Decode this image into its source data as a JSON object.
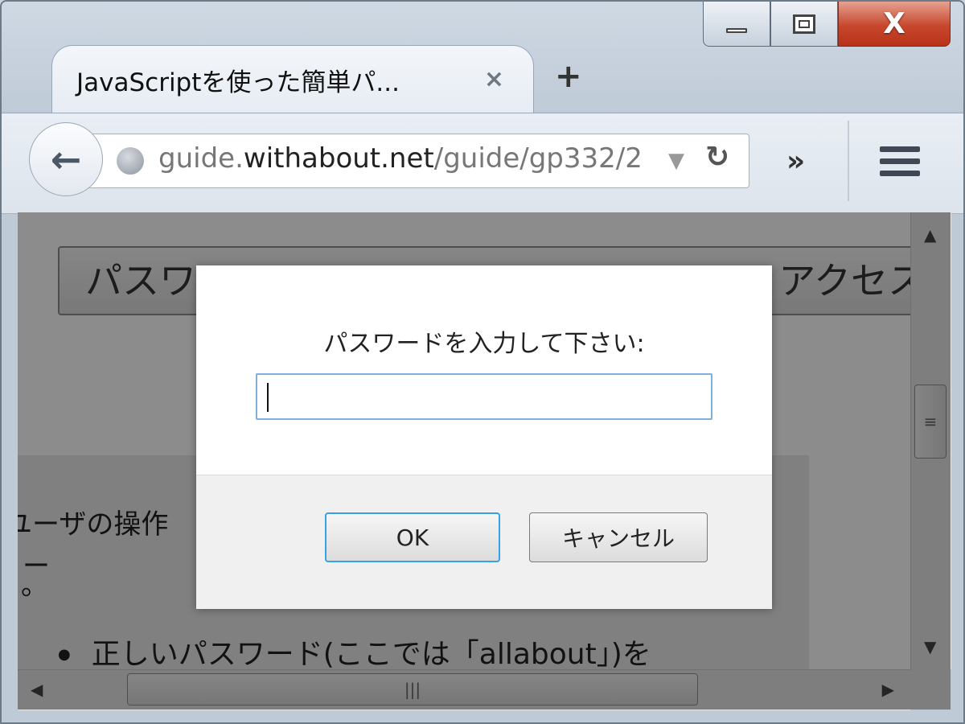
{
  "window": {
    "caption_buttons": [
      "minimize",
      "maximize",
      "close"
    ],
    "close_glyph": "X"
  },
  "tabs": [
    {
      "title": "JavaScriptを使った簡単パ...",
      "close_glyph": "×"
    }
  ],
  "new_tab_glyph": "+",
  "toolbar": {
    "back_glyph": "🡠",
    "url_prefix": "guide.",
    "url_domain": "withabout.net",
    "url_path": "/guide/gp332/2",
    "overflow_glyph": "»"
  },
  "page": {
    "button_text_left": "パスワ",
    "button_text_right": "アクセス",
    "body_line1": "ユーザの操作",
    "body_line2": "ー",
    "body_line3": "。",
    "bullet_text": "正しいパスワード(ここでは「allabout」)を"
  },
  "dialog": {
    "message": "パスワードを入力して下さい:",
    "input_value": "",
    "ok_label": "OK",
    "cancel_label": "キャンセル"
  },
  "colors": {
    "close_button": "#c7472d",
    "ok_focus": "#3aa0e4",
    "input_focus": "#7fb0db"
  }
}
